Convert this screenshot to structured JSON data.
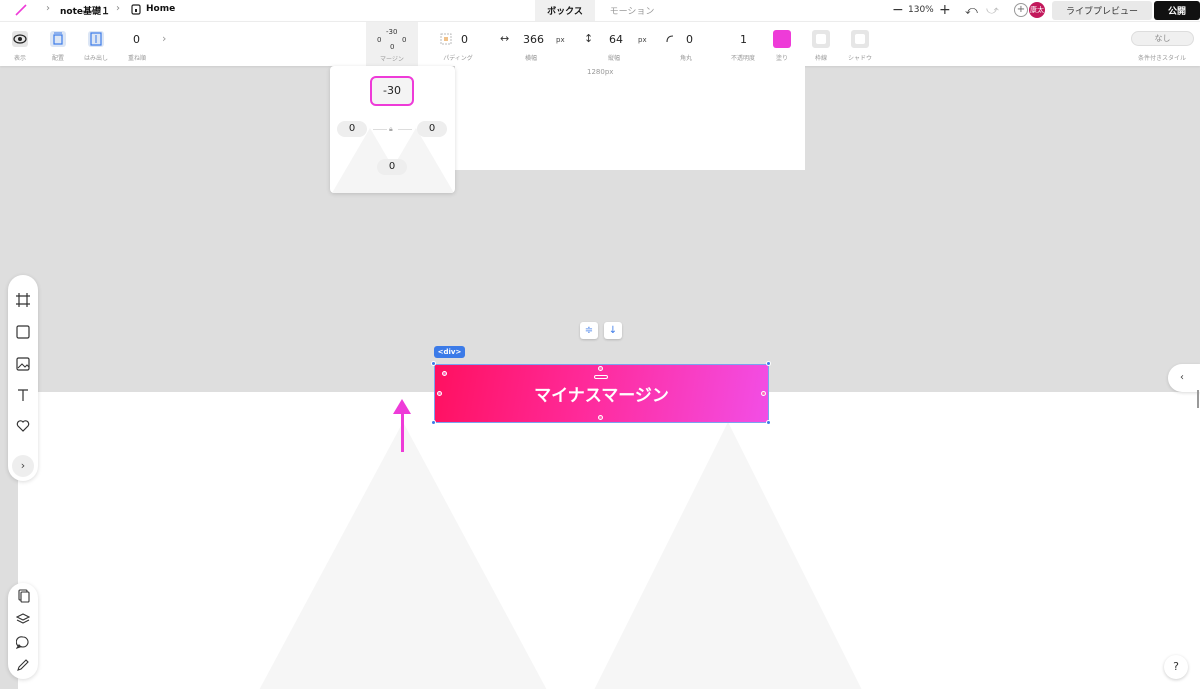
{
  "topbar": {
    "breadcrumb": {
      "project": "note基礎１",
      "page": "Home"
    },
    "tabs": [
      "ボックス",
      "モーション"
    ],
    "zoom": {
      "minus": "−",
      "value": "130%",
      "plus": "+"
    },
    "undo": "⤺",
    "redo": "⤻",
    "add": "+",
    "avatar": "康太",
    "live_preview": "ライブプレビュー",
    "publish": "公開"
  },
  "toolbar": {
    "display": "表示",
    "placement": "配置",
    "overflow": "はみ出し",
    "stack_order": {
      "value": "0",
      "label": "重ね順"
    },
    "margin_widget": {
      "top": "-30",
      "left": "0",
      "right": "0",
      "bottom": "0",
      "label": "マージン"
    },
    "padding": {
      "value": "0",
      "label": "パディング"
    },
    "width": {
      "value": "366",
      "unit": "px",
      "label": "横幅"
    },
    "height": {
      "value": "64",
      "unit": "px",
      "label": "縦幅"
    },
    "radius": {
      "value": "0",
      "label": "角丸"
    },
    "opacity": {
      "value": "1",
      "label": "不透明度"
    },
    "fill": {
      "label": "塗り",
      "color": "#ee3bd8"
    },
    "border": {
      "label": "枠線"
    },
    "shadow": {
      "label": "シャドウ"
    },
    "conditional": {
      "value": "なし",
      "label": "条件付きスタイル"
    }
  },
  "canvas": {
    "width_label": "1280px",
    "margin_popup": {
      "top": "-30",
      "left": "0",
      "right": "0",
      "bottom": "0"
    },
    "selected": {
      "tag": "<div>",
      "text": "マイナスマージン",
      "gradient": [
        "#ff1060",
        "#f24ee6"
      ]
    }
  },
  "colors": {
    "accent": "#ee3bd8",
    "selection": "#3c7be8"
  },
  "help": "?"
}
